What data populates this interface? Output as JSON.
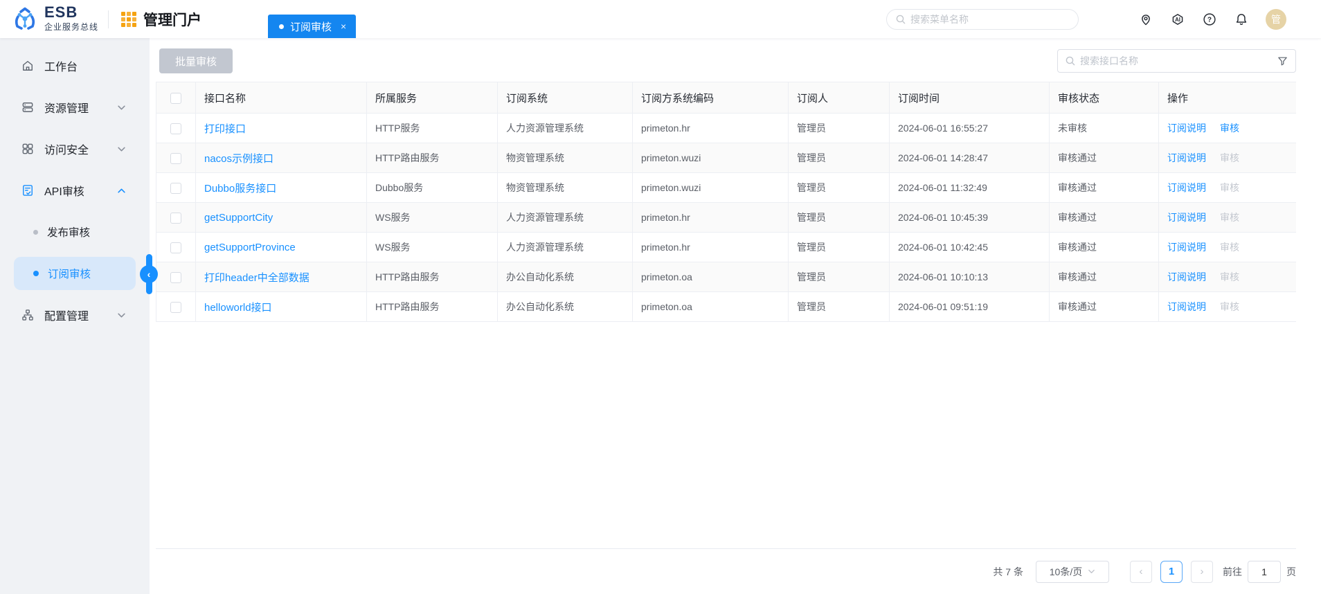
{
  "topbar": {
    "logo_title": "ESB",
    "logo_subtitle": "企业服务总线",
    "portal_label": "管理门户",
    "tab_label": "订阅审核",
    "tab_close": "×",
    "menu_search_placeholder": "搜索菜单名称",
    "icons": [
      "location-icon",
      "ai-icon",
      "help-icon",
      "bell-icon"
    ],
    "avatar_text": "管"
  },
  "sidebar": {
    "items": [
      {
        "id": "workbench",
        "label": "工作台",
        "icon": "home-icon",
        "type": "top"
      },
      {
        "id": "resource-mgmt",
        "label": "资源管理",
        "icon": "resource-icon",
        "type": "top",
        "chevron": "down"
      },
      {
        "id": "access-security",
        "label": "访问安全",
        "icon": "security-icon",
        "type": "top",
        "chevron": "down"
      },
      {
        "id": "api-audit",
        "label": "API审核",
        "icon": "audit-icon",
        "type": "top",
        "chevron": "up",
        "expanded": true
      },
      {
        "id": "publish-audit",
        "label": "发布审核",
        "type": "child",
        "active": false
      },
      {
        "id": "subscribe-audit",
        "label": "订阅审核",
        "type": "child",
        "active": true
      },
      {
        "id": "config-mgmt",
        "label": "配置管理",
        "icon": "config-icon",
        "type": "top",
        "chevron": "down"
      }
    ]
  },
  "toolbar": {
    "batch_audit": "批量审核",
    "search_placeholder": "搜索接口名称"
  },
  "table": {
    "columns": [
      "接口名称",
      "所属服务",
      "订阅系统",
      "订阅方系统编码",
      "订阅人",
      "订阅时间",
      "审核状态",
      "操作"
    ],
    "actions": {
      "desc": "订阅说明",
      "audit": "审核"
    },
    "rows": [
      {
        "name": "打印接口",
        "service": "HTTP服务",
        "system": "人力资源管理系统",
        "code": "primeton.hr",
        "subscriber": "管理员",
        "time": "2024-06-01 16:55:27",
        "status": "未审核",
        "audit_enabled": true
      },
      {
        "name": "nacos示例接口",
        "service": "HTTP路由服务",
        "system": "物资管理系统",
        "code": "primeton.wuzi",
        "subscriber": "管理员",
        "time": "2024-06-01 14:28:47",
        "status": "审核通过",
        "audit_enabled": false
      },
      {
        "name": "Dubbo服务接口",
        "service": "Dubbo服务",
        "system": "物资管理系统",
        "code": "primeton.wuzi",
        "subscriber": "管理员",
        "time": "2024-06-01 11:32:49",
        "status": "审核通过",
        "audit_enabled": false
      },
      {
        "name": "getSupportCity",
        "service": "WS服务",
        "system": "人力资源管理系统",
        "code": "primeton.hr",
        "subscriber": "管理员",
        "time": "2024-06-01 10:45:39",
        "status": "审核通过",
        "audit_enabled": false
      },
      {
        "name": "getSupportProvince",
        "service": "WS服务",
        "system": "人力资源管理系统",
        "code": "primeton.hr",
        "subscriber": "管理员",
        "time": "2024-06-01 10:42:45",
        "status": "审核通过",
        "audit_enabled": false
      },
      {
        "name": "打印header中全部数据",
        "service": "HTTP路由服务",
        "system": "办公自动化系统",
        "code": "primeton.oa",
        "subscriber": "管理员",
        "time": "2024-06-01 10:10:13",
        "status": "审核通过",
        "audit_enabled": false
      },
      {
        "name": "helloworld接口",
        "service": "HTTP路由服务",
        "system": "办公自动化系统",
        "code": "primeton.oa",
        "subscriber": "管理员",
        "time": "2024-06-01 09:51:19",
        "status": "审核通过",
        "audit_enabled": false
      }
    ]
  },
  "pagination": {
    "total": "共 7 条",
    "page_size": "10条/页",
    "prev": "‹",
    "next": "›",
    "current_page": "1",
    "goto_label": "前往",
    "goto_value": "1",
    "page_unit": "页"
  },
  "colors": {
    "primary": "#1890ff",
    "tab_bg": "#1486f0",
    "sidebar_bg": "#f0f2f5",
    "sidebar_active_bg": "#d8e8fa",
    "table_header_bg": "#fafafa",
    "stripe_bg": "#fafafa",
    "disabled_text": "#c3c7cf",
    "disabled_button_bg": "#c2c7d0",
    "portal_icon": "#f5a312",
    "avatar_bg": "#e6d3a6"
  }
}
